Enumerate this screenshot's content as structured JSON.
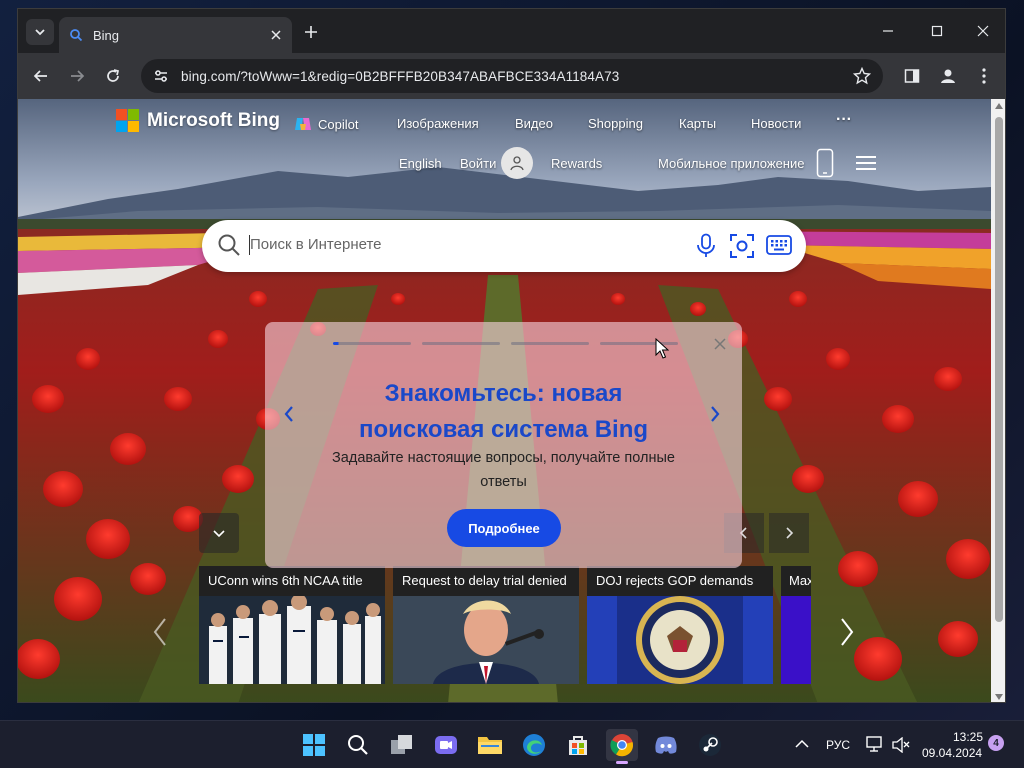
{
  "browser": {
    "tab_title": "Bing",
    "url": "bing.com/?toWww=1&redig=0B2BFFFB20B347ABAFBCE334A1184A73"
  },
  "bing": {
    "logo_text": "Microsoft Bing",
    "nav": {
      "copilot": "Copilot",
      "images": "Изображения",
      "video": "Видео",
      "shopping": "Shopping",
      "maps": "Карты",
      "news": "Новости",
      "more": "···"
    },
    "language": "English",
    "signin": "Войти",
    "rewards": "Rewards",
    "mobile_app": "Мобильное приложение",
    "search_placeholder": "Поиск в Интернете",
    "promo": {
      "title_line1": "Знакомьтесь: новая",
      "title_line2": "поисковая система Bing",
      "subtitle": "Задавайте настоящие вопросы, получайте полные ответы",
      "button": "Подробнее"
    },
    "news_cards": [
      {
        "title": "UConn wins 6th NCAA title"
      },
      {
        "title": "Request to delay trial denied"
      },
      {
        "title": "DOJ rejects GOP demands"
      },
      {
        "title": "Max"
      }
    ]
  },
  "taskbar": {
    "language": "РУС",
    "time": "13:25",
    "date": "09.04.2024",
    "notification_count": "4"
  },
  "colors": {
    "accent": "#174ae4",
    "browser_dark": "#202124",
    "toolbar": "#35363a"
  }
}
